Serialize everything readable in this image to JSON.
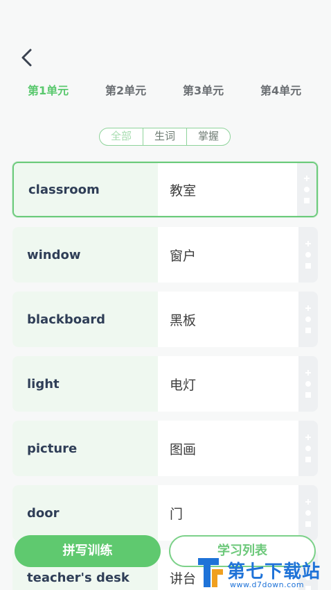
{
  "header": {
    "back_icon": "chevron-left-icon"
  },
  "units": {
    "tabs": [
      {
        "label": "第1单元",
        "active": true
      },
      {
        "label": "第2单元",
        "active": false
      },
      {
        "label": "第3单元",
        "active": false
      },
      {
        "label": "第4单元",
        "active": false
      }
    ]
  },
  "filter": {
    "options": [
      {
        "label": "全部",
        "active": true
      },
      {
        "label": "生词",
        "active": false
      },
      {
        "label": "掌握",
        "active": false
      }
    ]
  },
  "words": [
    {
      "en": "classroom",
      "zh": "教室",
      "selected": true
    },
    {
      "en": "window",
      "zh": "窗户",
      "selected": false
    },
    {
      "en": "blackboard",
      "zh": "黑板",
      "selected": false
    },
    {
      "en": "light",
      "zh": "电灯",
      "selected": false
    },
    {
      "en": "picture",
      "zh": "图画",
      "selected": false
    },
    {
      "en": "door",
      "zh": "门",
      "selected": false
    },
    {
      "en": "teacher's desk",
      "zh": "讲台",
      "selected": false
    }
  ],
  "actions": {
    "icons": [
      "plus-icon",
      "dot-icon",
      "square-icon"
    ]
  },
  "bottom": {
    "practice_label": "拼写训练",
    "list_label": "学习列表"
  },
  "watermark": {
    "title": "第七下载站",
    "url": "www.d7down.com"
  },
  "colors": {
    "accent_green": "#5fc96f",
    "word_bg": "#eff8f0",
    "text_dark": "#2f3e57",
    "watermark_blue": "#1f73d8"
  }
}
